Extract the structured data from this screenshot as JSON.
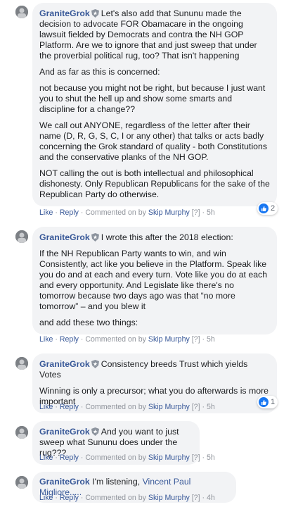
{
  "comments": [
    {
      "author": "GraniteGrok",
      "paragraphs": [
        "Let's also add that Sununu made the decision to advocate FOR Obamacare in the ongoing lawsuit fielded by Democrats and contra the NH GOP Platform. Are we to ignore that and just sweep that under the proverbial political rug, too? That isn't happening",
        "And as far as this is concerned:",
        "not because you might not be right, but because I just want you to shut the hell up and show some smarts and discipline for a change??",
        "We call out ANYONE, regardless of the letter after their name (D, R, G, S, C, I or any other) that talks or acts badly concerning the Grok standard of quality - both Constitutions and the conservative planks of the NH GOP.",
        "NOT calling the out is both intellectual and philosophical dishonesty. Only Republican Republicans for the sake of the Republican Party do otherwise."
      ],
      "like": "Like",
      "reply": "Reply",
      "commented_on_by": "Commented on by",
      "moderator": "Skip Murphy",
      "badge": "[?]",
      "time": "5h",
      "reaction_count": "2"
    },
    {
      "author": "GraniteGrok",
      "paragraphs": [
        "I wrote this after the 2018 election:",
        "If the NH Republican Party wants to win, and win Consistently, act like you believe in the Platform. Speak like you do and at each and every turn. Vote like you do at each and every opportunity. And Legislate like there's no tomorrow because two days ago was that “no more tomorrow” – and you blew it",
        "and add these two things:"
      ],
      "like": "Like",
      "reply": "Reply",
      "commented_on_by": "Commented on by",
      "moderator": "Skip Murphy",
      "badge": "[?]",
      "time": "5h"
    },
    {
      "author": "GraniteGrok",
      "paragraphs": [
        "Consistency breeds Trust which yields Votes",
        "Winning is only a precursor; what you do afterwards is more important"
      ],
      "like": "Like",
      "reply": "Reply",
      "commented_on_by": "Commented on by",
      "moderator": "Skip Murphy",
      "badge": "[?]",
      "time": "5h",
      "reaction_count": "1"
    },
    {
      "author": "GraniteGrok",
      "paragraphs": [
        "And you want to just sweep what Sununu does under the rug???"
      ],
      "like": "Like",
      "reply": "Reply",
      "commented_on_by": "Commented on by",
      "moderator": "Skip Murphy",
      "badge": "[?]",
      "time": "5h"
    },
    {
      "author": "GraniteGrok",
      "text": "I'm listening,",
      "mention": "Vincent Paul Migliore.....",
      "like": "Like",
      "reply": "Reply",
      "commented_on_by": "Commented on by",
      "moderator": "Skip Murphy",
      "badge": "[?]",
      "time": "4h"
    }
  ],
  "colors": {
    "link": "#385898",
    "bubble": "#f2f3f5",
    "muted": "#90949c",
    "like_blue": "#1877f2"
  }
}
